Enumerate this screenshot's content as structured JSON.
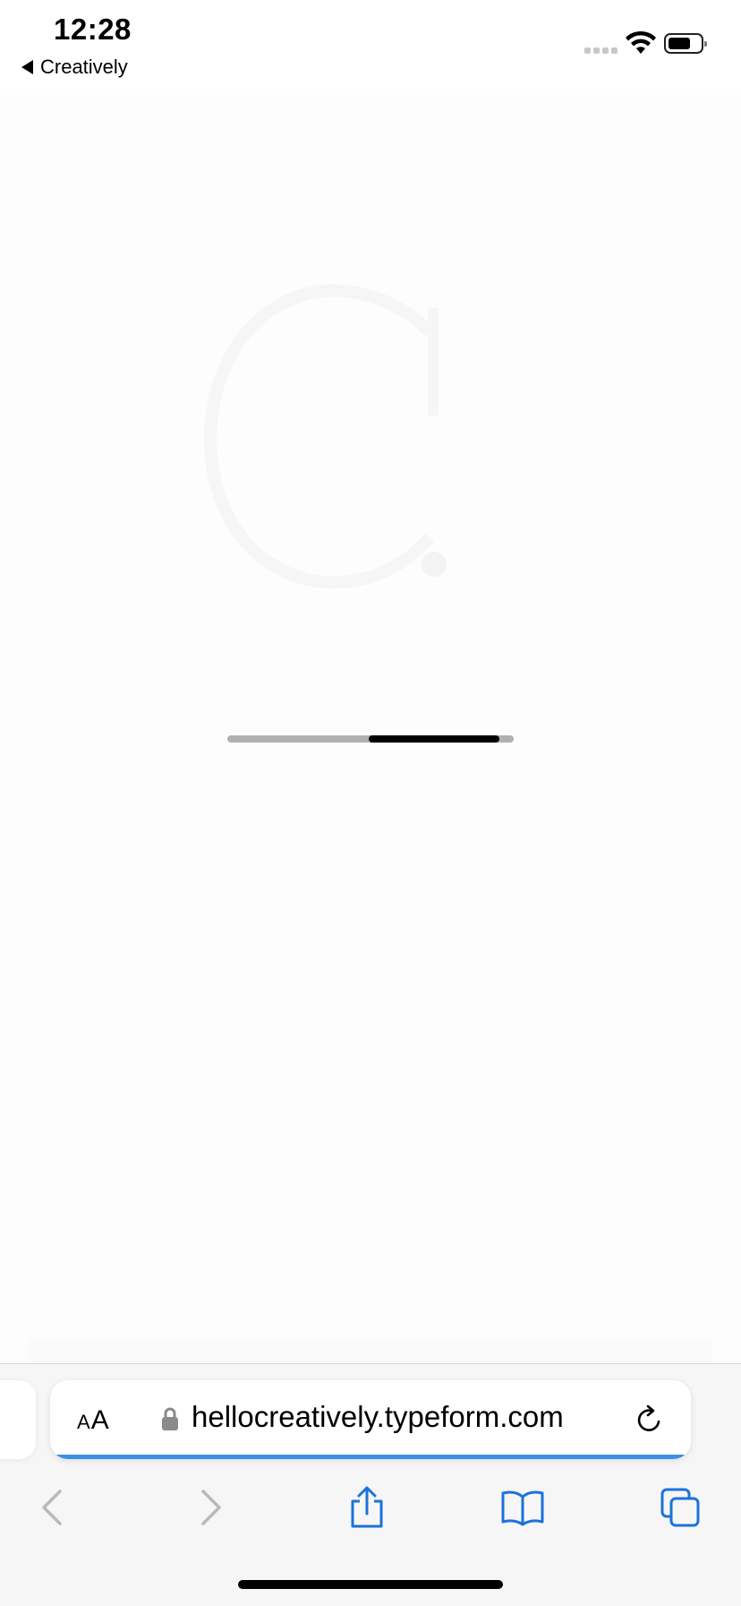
{
  "status_bar": {
    "time": "12:28",
    "back_app_label": "Creatively",
    "icons": [
      "signal-dots-icon",
      "wifi-icon",
      "battery-icon"
    ]
  },
  "page": {
    "loading": true,
    "logo_letter": "C",
    "scroll_progress": 0.8
  },
  "browser": {
    "text_size_label_small": "A",
    "text_size_label_large": "A",
    "url": "hellocreatively.typeform.com",
    "load_progress": 1.0,
    "toolbar": [
      "back-icon",
      "forward-icon",
      "share-icon",
      "bookmarks-icon",
      "tabs-icon"
    ]
  },
  "colors": {
    "accent": "#1a73d9",
    "progress": "#3a8ee6",
    "chrome_bg": "#f6f6f6"
  }
}
